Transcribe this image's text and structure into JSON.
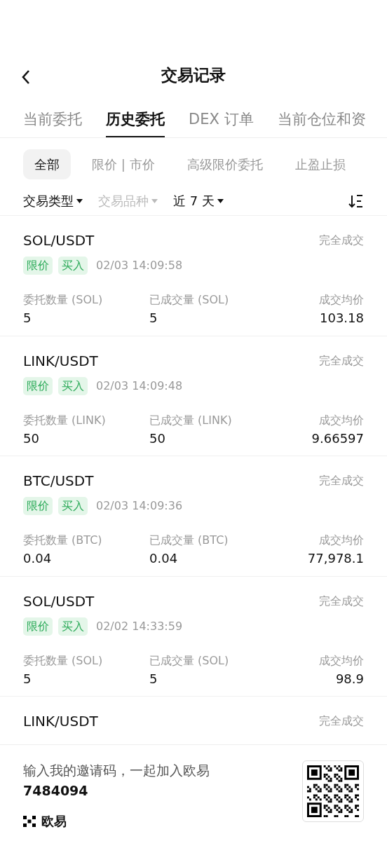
{
  "header": {
    "title": "交易记录"
  },
  "tabs": [
    {
      "label": "当前委托",
      "selected": false
    },
    {
      "label": "历史委托",
      "selected": true
    },
    {
      "label": "DEX 订单",
      "selected": false
    },
    {
      "label": "当前仓位和资",
      "selected": false
    }
  ],
  "order_types": [
    {
      "label": "全部",
      "selected": true
    },
    {
      "label": "限价 | 市价",
      "selected": false
    },
    {
      "label": "高级限价委托",
      "selected": false
    },
    {
      "label": "止盈止损",
      "selected": false
    }
  ],
  "filters": [
    {
      "label": "交易类型",
      "disabled": false
    },
    {
      "label": "交易品种",
      "disabled": true
    },
    {
      "label": "近 7 天",
      "disabled": false
    }
  ],
  "orders": [
    {
      "pair": "SOL/USDT",
      "status": "完全成交",
      "tags": [
        "限价",
        "买入"
      ],
      "time": "02/03 14:09:58",
      "fields": [
        {
          "label": "委托数量 (SOL)",
          "value": "5"
        },
        {
          "label": "已成交量 (SOL)",
          "value": "5"
        },
        {
          "label": "成交均价",
          "value": "103.18"
        }
      ]
    },
    {
      "pair": "LINK/USDT",
      "status": "完全成交",
      "tags": [
        "限价",
        "买入"
      ],
      "time": "02/03 14:09:48",
      "fields": [
        {
          "label": "委托数量 (LINK)",
          "value": "50"
        },
        {
          "label": "已成交量 (LINK)",
          "value": "50"
        },
        {
          "label": "成交均价",
          "value": "9.66597"
        }
      ]
    },
    {
      "pair": "BTC/USDT",
      "status": "完全成交",
      "tags": [
        "限价",
        "买入"
      ],
      "time": "02/03 14:09:36",
      "fields": [
        {
          "label": "委托数量 (BTC)",
          "value": "0.04"
        },
        {
          "label": "已成交量 (BTC)",
          "value": "0.04"
        },
        {
          "label": "成交均价",
          "value": "77,978.1"
        }
      ]
    },
    {
      "pair": "SOL/USDT",
      "status": "完全成交",
      "tags": [
        "限价",
        "买入"
      ],
      "time": "02/02 14:33:59",
      "fields": [
        {
          "label": "委托数量 (SOL)",
          "value": "5"
        },
        {
          "label": "已成交量 (SOL)",
          "value": "5"
        },
        {
          "label": "成交均价",
          "value": "98.9"
        }
      ]
    },
    {
      "pair": "LINK/USDT",
      "status": "完全成交"
    }
  ],
  "footer": {
    "invite": "输入我的邀请码，一起加入欧易",
    "code": "7484094",
    "brand": "欧易"
  }
}
